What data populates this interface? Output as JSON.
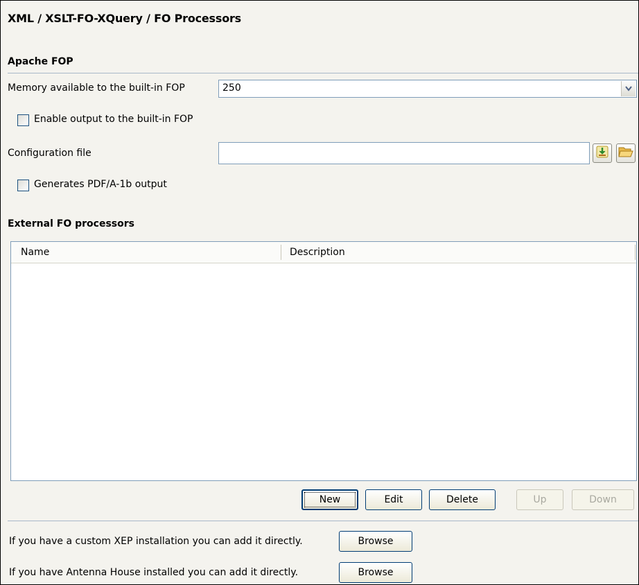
{
  "page": {
    "title": "XML / XSLT-FO-XQuery / FO Processors"
  },
  "apache_fop": {
    "section_label": "Apache FOP",
    "memory_label": "Memory available to the built-in FOP",
    "memory_value": "250",
    "enable_output_label": "Enable output to the built-in FOP",
    "enable_output_checked": false,
    "config_file_label": "Configuration file",
    "config_file_value": "",
    "pdfa_label": "Generates PDF/A-1b output",
    "pdfa_checked": false
  },
  "external": {
    "section_label": "External FO processors",
    "columns": [
      "Name",
      "Description"
    ],
    "rows": [],
    "buttons": {
      "new": "New",
      "edit": "Edit",
      "delete": "Delete",
      "up": "Up",
      "down": "Down"
    }
  },
  "footer": {
    "xep_text": "If you have a custom XEP installation you can add it directly.",
    "xep_button": "Browse",
    "antenna_text": "If you have Antenna House installed you can add it directly.",
    "antenna_button": "Browse"
  },
  "icons": {
    "combo_arrow": "chevron-down-icon",
    "insert_editor_variables": "download-arrow-icon",
    "browse_folder": "folder-open-icon"
  }
}
